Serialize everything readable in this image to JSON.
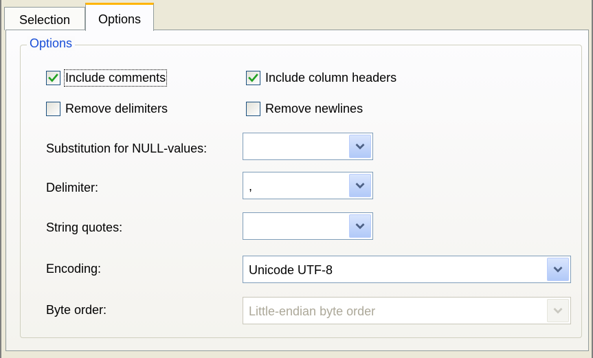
{
  "tabs": [
    {
      "label": "Selection",
      "active": false
    },
    {
      "label": "Options",
      "active": true
    }
  ],
  "group": {
    "title": "Options"
  },
  "checkboxes": {
    "include_comments": {
      "label": "Include comments",
      "checked": true
    },
    "include_column_headers": {
      "label": "Include column headers",
      "checked": true
    },
    "remove_delimiters": {
      "label": "Remove delimiters",
      "checked": false
    },
    "remove_newlines": {
      "label": "Remove newlines",
      "checked": false
    }
  },
  "fields": {
    "null_substitution": {
      "label": "Substitution for NULL-values:",
      "value": ""
    },
    "delimiter": {
      "label": "Delimiter:",
      "value": ","
    },
    "string_quotes": {
      "label": "String quotes:",
      "value": ""
    },
    "encoding": {
      "label": "Encoding:",
      "value": "Unicode UTF-8"
    },
    "byte_order": {
      "label": "Byte order:",
      "value": "Little-endian byte order",
      "disabled": true
    }
  },
  "colors": {
    "active_tab_accent": "#ffb400",
    "group_title": "#1a4fd8",
    "checkmark": "#21a121",
    "dropdown_arrow": "#4d6185"
  },
  "icons": {
    "check": "checkmark-icon",
    "dropdown": "chevron-down-icon"
  }
}
